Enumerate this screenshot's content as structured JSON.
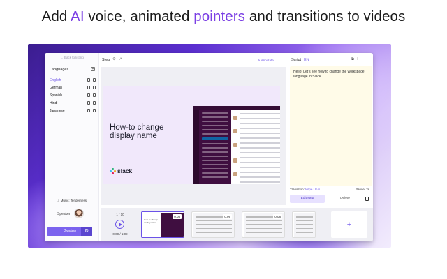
{
  "headline": {
    "part1": "Add ",
    "accent1": "AI",
    "part2": " voice, animated ",
    "accent2": "pointers",
    "part3": " and transitions to videos"
  },
  "colors": {
    "accent": "#7b3fe4",
    "primary_button": "#7b63ee",
    "script_bg": "#fffbe8"
  },
  "left_panel": {
    "back_label": "← Back to listing",
    "languages_title": "Languages",
    "add_icon": "plus-square-icon",
    "languages": [
      {
        "name": "English",
        "active": true
      },
      {
        "name": "German",
        "active": false
      },
      {
        "name": "Spanish",
        "active": false
      },
      {
        "name": "Hindi",
        "active": false
      },
      {
        "name": "Japanese",
        "active": false
      }
    ],
    "music_label": "Music: Tenderness",
    "speaker_label": "Speaker:",
    "preview_label": "Preview"
  },
  "center": {
    "step_label": "Step",
    "annotate_label": "Annotate",
    "slide_title": "How-to change display name",
    "slide_brand": "slack"
  },
  "right_panel": {
    "script_label": "Script",
    "script_lang": "EN",
    "script_text": "Hello! Let's see how to change the workspace language in Slack.",
    "transition_label": "Transition:",
    "transition_value": "Wipe Up",
    "pause_label": "Pause: 2s",
    "edit_step_label": "Edit step",
    "delete_label": "Delete"
  },
  "timeline": {
    "count": "1 / 10",
    "time": "0:00 / 1:09",
    "thumbnails": [
      {
        "duration": "0:08",
        "selected": true
      },
      {
        "duration": "0:09",
        "selected": false
      },
      {
        "duration": "0:08",
        "selected": false
      },
      {
        "duration": "",
        "selected": false
      }
    ],
    "add_label": "+"
  }
}
